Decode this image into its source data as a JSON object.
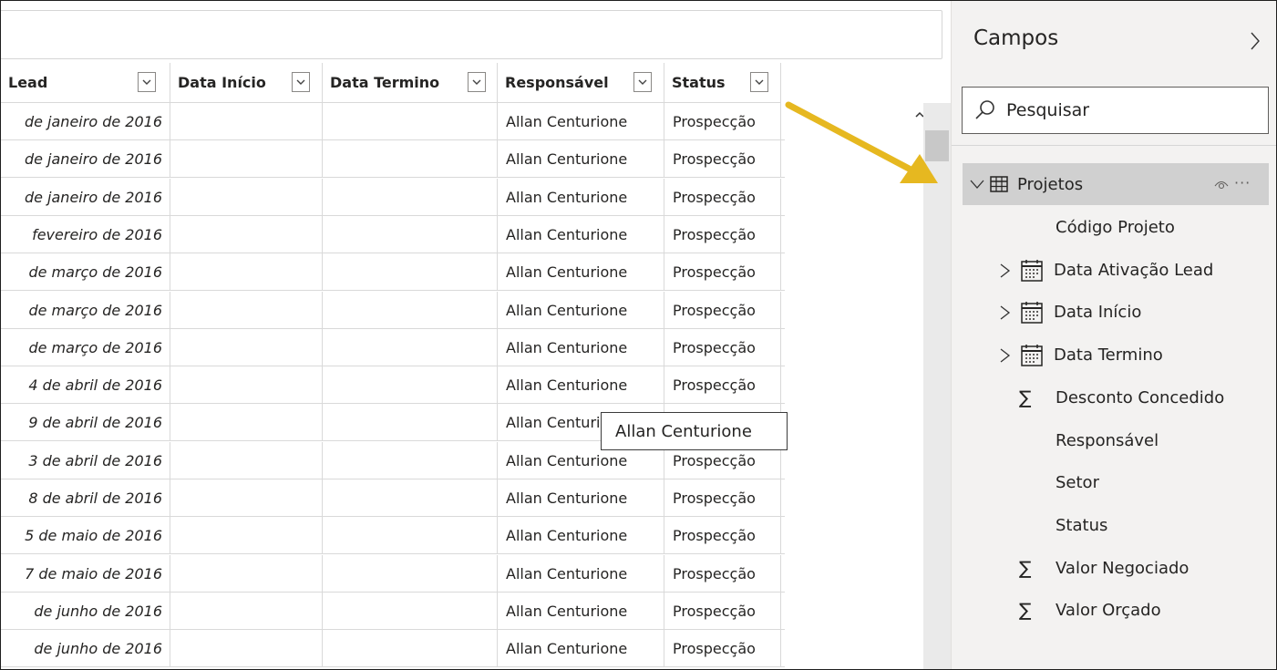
{
  "grid": {
    "headers": {
      "lead": "Lead",
      "data_inicio": "Data Início",
      "data_termino": "Data Termino",
      "responsavel": "Responsável",
      "status": "Status"
    },
    "rows": [
      {
        "lead": "de janeiro de 2016",
        "data_inicio": "",
        "data_termino": "",
        "responsavel": "Allan Centurione",
        "status": "Prospecção"
      },
      {
        "lead": "de janeiro de 2016",
        "data_inicio": "",
        "data_termino": "",
        "responsavel": "Allan Centurione",
        "status": "Prospecção"
      },
      {
        "lead": "de janeiro de 2016",
        "data_inicio": "",
        "data_termino": "",
        "responsavel": "Allan Centurione",
        "status": "Prospecção"
      },
      {
        "lead": "fevereiro de 2016",
        "data_inicio": "",
        "data_termino": "",
        "responsavel": "Allan Centurione",
        "status": "Prospecção"
      },
      {
        "lead": "de março de 2016",
        "data_inicio": "",
        "data_termino": "",
        "responsavel": "Allan Centurione",
        "status": "Prospecção"
      },
      {
        "lead": "de março de 2016",
        "data_inicio": "",
        "data_termino": "",
        "responsavel": "Allan Centurione",
        "status": "Prospecção"
      },
      {
        "lead": "de março de 2016",
        "data_inicio": "",
        "data_termino": "",
        "responsavel": "Allan Centurione",
        "status": "Prospecção"
      },
      {
        "lead": "4 de abril de 2016",
        "data_inicio": "",
        "data_termino": "",
        "responsavel": "Allan Centurione",
        "status": "Prospecção"
      },
      {
        "lead": "9 de abril de 2016",
        "data_inicio": "",
        "data_termino": "",
        "responsavel": "Allan Centurione",
        "status": "Prospecção"
      },
      {
        "lead": "3 de abril de 2016",
        "data_inicio": "",
        "data_termino": "",
        "responsavel": "Allan Centurione",
        "status": "Prospecção"
      },
      {
        "lead": "8 de abril de 2016",
        "data_inicio": "",
        "data_termino": "",
        "responsavel": "Allan Centurione",
        "status": "Prospecção"
      },
      {
        "lead": "5 de maio de 2016",
        "data_inicio": "",
        "data_termino": "",
        "responsavel": "Allan Centurione",
        "status": "Prospecção"
      },
      {
        "lead": "7 de maio de 2016",
        "data_inicio": "",
        "data_termino": "",
        "responsavel": "Allan Centurione",
        "status": "Prospecção"
      },
      {
        "lead": "de junho de 2016",
        "data_inicio": "",
        "data_termino": "",
        "responsavel": "Allan Centurione",
        "status": "Prospecção"
      },
      {
        "lead": "de junho de 2016",
        "data_inicio": "",
        "data_termino": "",
        "responsavel": "Allan Centurione",
        "status": "Prospecção"
      }
    ],
    "tooltip": "Allan Centurione"
  },
  "fields_pane": {
    "title": "Campos",
    "search_placeholder": "Pesquisar",
    "table_name": "Projetos",
    "fields": [
      {
        "label": "Código Projeto",
        "kind": "text"
      },
      {
        "label": "Data Ativação Lead",
        "kind": "date"
      },
      {
        "label": "Data Início",
        "kind": "date"
      },
      {
        "label": "Data Termino",
        "kind": "date"
      },
      {
        "label": "Desconto Concedido",
        "kind": "sum"
      },
      {
        "label": "Responsável",
        "kind": "text"
      },
      {
        "label": "Setor",
        "kind": "text"
      },
      {
        "label": "Status",
        "kind": "text"
      },
      {
        "label": "Valor Negociado",
        "kind": "sum"
      },
      {
        "label": "Valor Orçado",
        "kind": "sum"
      }
    ]
  },
  "colors": {
    "arrow": "#e6b820",
    "pane_bg": "#f3f2f1",
    "selected_table_bg": "#d0d0d0"
  }
}
